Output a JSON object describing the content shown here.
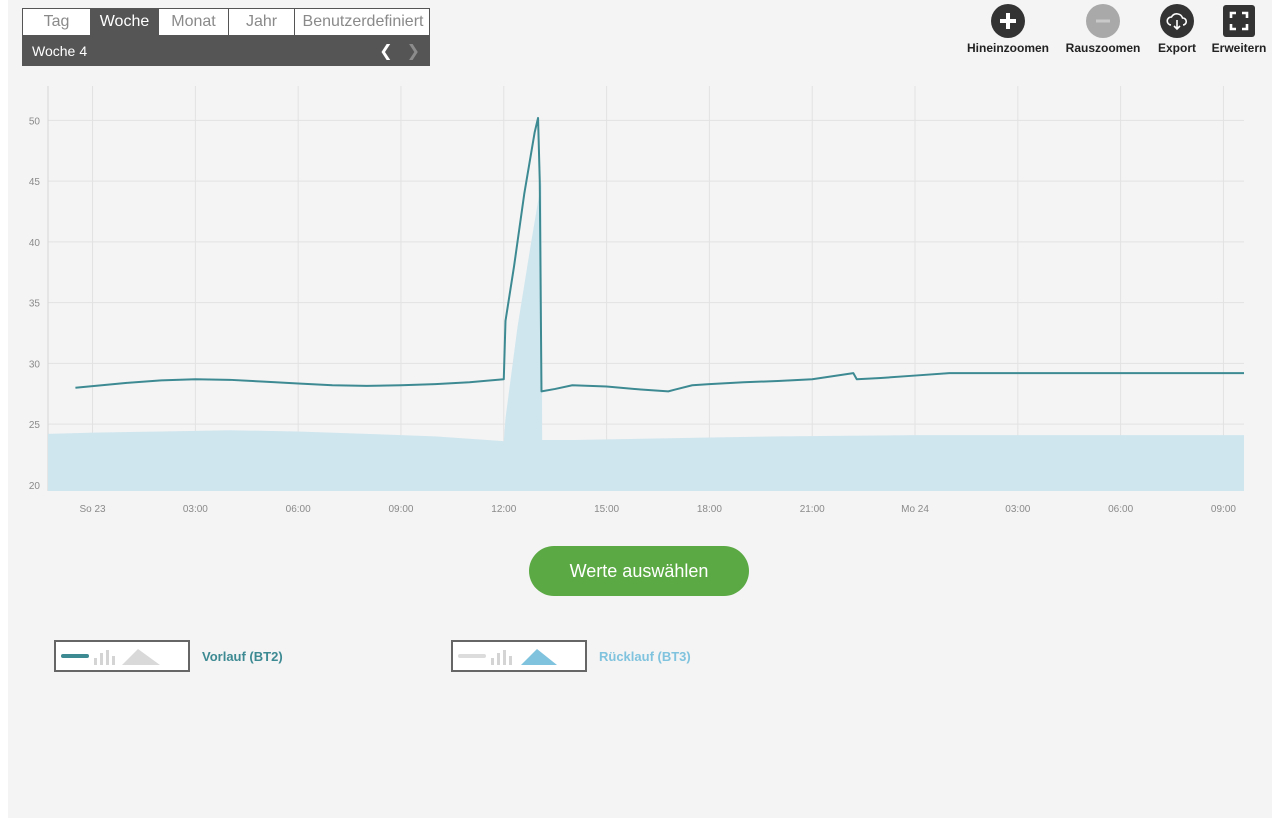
{
  "period": {
    "tabs": [
      {
        "label": "Tag",
        "active": false
      },
      {
        "label": "Woche",
        "active": true
      },
      {
        "label": "Monat",
        "active": false
      },
      {
        "label": "Jahr",
        "active": false
      },
      {
        "label": "Benutzerdefiniert",
        "active": false
      }
    ],
    "week_label": "Woche",
    "week_number": "4"
  },
  "toolbar": {
    "zoom_in_label": "Hineinzoomen",
    "zoom_out_label": "Rauszoomen",
    "export_label": "Export",
    "expand_label": "Erweitern"
  },
  "select_values_label": "Werte auswählen",
  "legend": {
    "vorlauf_label": "Vorlauf (BT2)",
    "ruecklauf_label": "Rücklauf (BT3)"
  },
  "colors": {
    "vorlauf": "#3d8a93",
    "ruecklauf_fill": "#d0e6ee",
    "ruecklauf_legend": "#7fc3de",
    "button_green": "#5ba944",
    "grid": "#e2e2e2"
  },
  "chart_data": {
    "type": "area",
    "ylim": [
      19.5,
      52.5
    ],
    "yticks": [
      20,
      25,
      30,
      35,
      40,
      45,
      50
    ],
    "xticks": [
      {
        "h": 0,
        "label": "So 23"
      },
      {
        "h": 3,
        "label": "03:00"
      },
      {
        "h": 6,
        "label": "06:00"
      },
      {
        "h": 9,
        "label": "09:00"
      },
      {
        "h": 12,
        "label": "12:00"
      },
      {
        "h": 15,
        "label": "15:00"
      },
      {
        "h": 18,
        "label": "18:00"
      },
      {
        "h": 21,
        "label": "21:00"
      },
      {
        "h": 24,
        "label": "Mo 24"
      },
      {
        "h": 27,
        "label": "03:00"
      },
      {
        "h": 30,
        "label": "06:00"
      },
      {
        "h": 33,
        "label": "09:00"
      }
    ],
    "xlim": [
      -1.3,
      33.6
    ],
    "series": [
      {
        "name": "Vorlauf (BT2)",
        "type": "line",
        "x": [
          -0.5,
          1,
          2,
          3,
          4,
          5,
          6,
          7,
          8,
          9,
          10,
          11,
          12,
          12.05,
          12.3,
          12.6,
          12.9,
          13.0,
          13.05,
          13.1,
          13.5,
          14,
          15,
          16,
          16.8,
          17.0,
          17.5,
          18,
          19,
          20,
          21,
          22.2,
          22.3,
          23,
          24,
          25,
          26,
          27,
          28,
          29,
          30,
          31,
          32,
          33,
          33.6
        ],
        "values": [
          28.0,
          28.4,
          28.6,
          28.7,
          28.65,
          28.5,
          28.35,
          28.2,
          28.15,
          28.2,
          28.3,
          28.45,
          28.7,
          33.5,
          38,
          44,
          49,
          50.2,
          45,
          27.7,
          27.9,
          28.2,
          28.1,
          27.85,
          27.7,
          27.85,
          28.2,
          28.3,
          28.45,
          28.55,
          28.7,
          29.2,
          28.7,
          28.8,
          29.0,
          29.2,
          29.2,
          29.2,
          29.2,
          29.2,
          29.2,
          29.2,
          29.2,
          29.2,
          29.2
        ]
      },
      {
        "name": "Rücklauf (BT3)",
        "type": "area",
        "x": [
          -1.3,
          0,
          2,
          4,
          6,
          8,
          10,
          11,
          12,
          12.05,
          12.4,
          12.8,
          13.1,
          13.12,
          14,
          16,
          18,
          20,
          22,
          24,
          26,
          28,
          30,
          32,
          33.6
        ],
        "values": [
          24.2,
          24.3,
          24.4,
          24.5,
          24.4,
          24.2,
          24.0,
          23.8,
          23.6,
          25.5,
          33,
          40,
          45,
          23.7,
          23.7,
          23.8,
          23.9,
          24.0,
          24.05,
          24.1,
          24.1,
          24.1,
          24.1,
          24.1,
          24.1
        ]
      }
    ]
  }
}
